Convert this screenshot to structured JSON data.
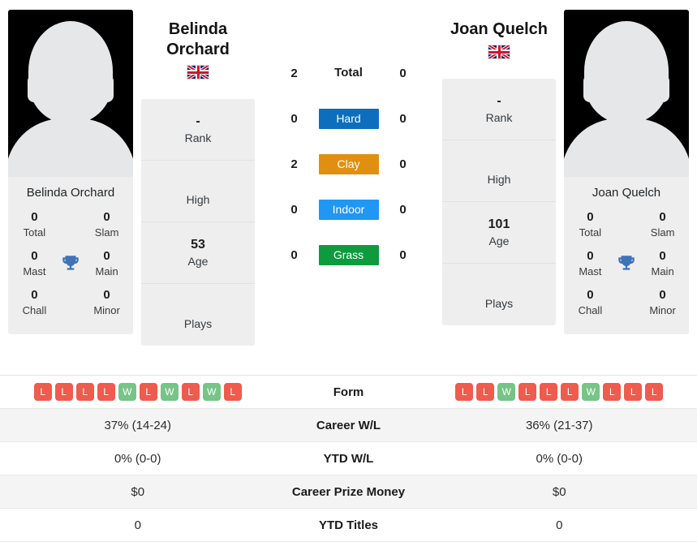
{
  "players": {
    "left": {
      "name": "Belinda Orchard",
      "name_line1": "Belinda",
      "name_line2": "Orchard",
      "caption": "Belinda Orchard",
      "flag": "uk-flag-icon",
      "avatar": "player-avatar-placeholder",
      "titles": {
        "total_value": "0",
        "total_label": "Total",
        "slam_value": "0",
        "slam_label": "Slam",
        "mast_value": "0",
        "mast_label": "Mast",
        "main_value": "0",
        "main_label": "Main",
        "chall_value": "0",
        "chall_label": "Chall",
        "minor_value": "0",
        "minor_label": "Minor",
        "trophy_icon": "trophy-icon"
      },
      "info": [
        {
          "value": "-",
          "label": "Rank"
        },
        {
          "value": "",
          "label": "High"
        },
        {
          "value": "53",
          "label": "Age"
        },
        {
          "value": "",
          "label": "Plays"
        }
      ],
      "form": [
        "L",
        "L",
        "L",
        "L",
        "W",
        "L",
        "W",
        "L",
        "W",
        "L"
      ],
      "career_wl": "37% (14-24)",
      "ytd_wl": "0% (0-0)",
      "career_prize_money": "$0",
      "ytd_titles": "0"
    },
    "right": {
      "name": "Joan Quelch",
      "name_line1": "Joan Quelch",
      "name_line2": "",
      "caption": "Joan Quelch",
      "flag": "uk-flag-icon",
      "avatar": "player-avatar-placeholder",
      "titles": {
        "total_value": "0",
        "total_label": "Total",
        "slam_value": "0",
        "slam_label": "Slam",
        "mast_value": "0",
        "mast_label": "Mast",
        "main_value": "0",
        "main_label": "Main",
        "chall_value": "0",
        "chall_label": "Chall",
        "minor_value": "0",
        "minor_label": "Minor",
        "trophy_icon": "trophy-icon"
      },
      "info": [
        {
          "value": "-",
          "label": "Rank"
        },
        {
          "value": "",
          "label": "High"
        },
        {
          "value": "101",
          "label": "Age"
        },
        {
          "value": "",
          "label": "Plays"
        }
      ],
      "form": [
        "L",
        "L",
        "W",
        "L",
        "L",
        "L",
        "W",
        "L",
        "L",
        "L"
      ],
      "career_wl": "36% (21-37)",
      "ytd_wl": "0% (0-0)",
      "career_prize_money": "$0",
      "ytd_titles": "0"
    }
  },
  "head_to_head": {
    "total": {
      "label": "Total",
      "left": "2",
      "right": "0"
    },
    "surfaces": [
      {
        "label": "Hard",
        "left": "0",
        "right": "0",
        "color": "#0d6ebd"
      },
      {
        "label": "Clay",
        "left": "2",
        "right": "0",
        "color": "#e09010"
      },
      {
        "label": "Indoor",
        "left": "0",
        "right": "0",
        "color": "#2196f3"
      },
      {
        "label": "Grass",
        "left": "0",
        "right": "0",
        "color": "#0e9b3e"
      }
    ]
  },
  "table": {
    "rows": [
      {
        "label": "Form",
        "left": "",
        "right": ""
      },
      {
        "label": "Career W/L",
        "left": "37% (14-24)",
        "right": "36% (21-37)"
      },
      {
        "label": "YTD W/L",
        "left": "0% (0-0)",
        "right": "0% (0-0)"
      },
      {
        "label": "Career Prize Money",
        "left": "$0",
        "right": "$0"
      },
      {
        "label": "YTD Titles",
        "left": "0",
        "right": "0"
      }
    ]
  },
  "colors": {
    "win": "#77c487",
    "loss": "#ef5b4c",
    "trophy": "#3f72b8",
    "card_bg": "#eeeeee",
    "row_alt": "#f4f4f4"
  }
}
